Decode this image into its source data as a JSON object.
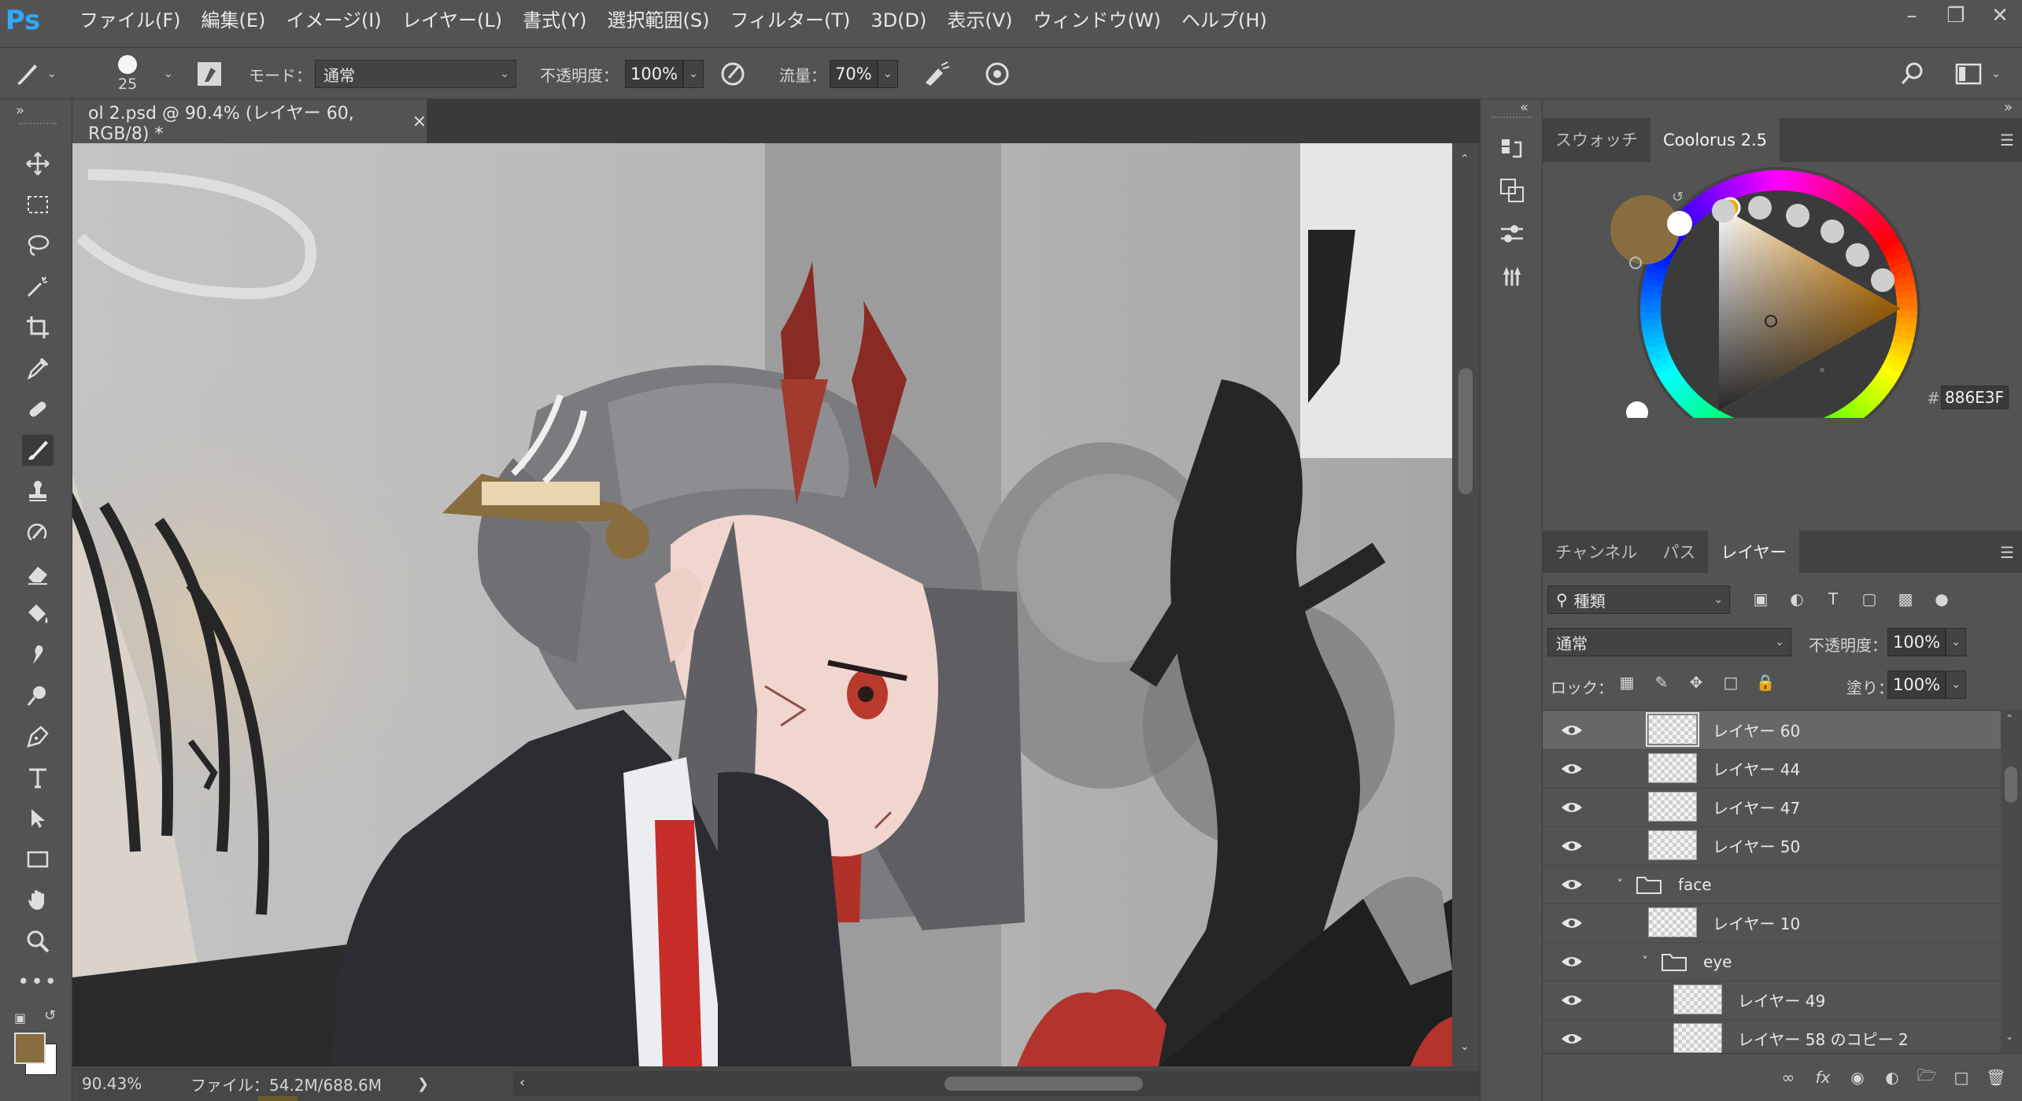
{
  "app": {
    "logo": "Ps",
    "menus": [
      "ファイル(F)",
      "編集(E)",
      "イメージ(I)",
      "レイヤー(L)",
      "書式(Y)",
      "選択範囲(S)",
      "フィルター(T)",
      "3D(D)",
      "表示(V)",
      "ウィンドウ(W)",
      "ヘルプ(H)"
    ]
  },
  "options": {
    "brush_size": "25",
    "mode_label": "モード：",
    "mode_value": "通常",
    "opacity_label": "不透明度：",
    "opacity_value": "100%",
    "flow_label": "流量：",
    "flow_value": "70%"
  },
  "document": {
    "tab_title": "ol 2.psd @ 90.4% (レイヤー 60, RGB/8) *",
    "close": "×",
    "zoom": "90.43%",
    "file_info": "ファイル：54.2M/688.6M"
  },
  "panels": {
    "top_tabs": [
      "スウォッチ",
      "Coolorus 2.5"
    ],
    "active_top_tab": 1,
    "color_hex_label": "#",
    "color_hex": "886E3F",
    "foreground_color": "#886E3F",
    "layer_tabs": [
      "チャンネル",
      "パス",
      "レイヤー"
    ],
    "active_layer_tab": 2,
    "filter_kind": "種類",
    "blend_mode": "通常",
    "opacity_label": "不透明度：",
    "opacity_value": "100%",
    "lock_label": "ロック：",
    "fill_label": "塗り：",
    "fill_value": "100%",
    "layers": [
      {
        "name": "レイヤー 60",
        "type": "layer",
        "indent": 0,
        "selected": true
      },
      {
        "name": "レイヤー 44",
        "type": "layer",
        "indent": 0
      },
      {
        "name": "レイヤー 47",
        "type": "layer",
        "indent": 0
      },
      {
        "name": "レイヤー 50",
        "type": "layer",
        "indent": 0
      },
      {
        "name": "face",
        "type": "group",
        "indent": 0
      },
      {
        "name": "レイヤー 10",
        "type": "layer",
        "indent": 0
      },
      {
        "name": "eye",
        "type": "group",
        "indent": 1
      },
      {
        "name": "レイヤー 49",
        "type": "layer",
        "indent": 1
      },
      {
        "name": "レイヤー 58 のコピー 2",
        "type": "layer",
        "indent": 1
      }
    ]
  }
}
